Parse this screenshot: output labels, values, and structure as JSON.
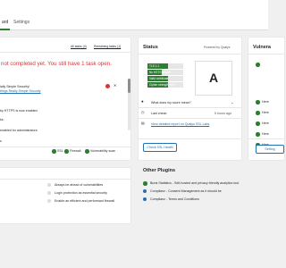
{
  "tabs": [
    {
      "label": "ard"
    },
    {
      "label": "Settings"
    }
  ],
  "progress": {
    "filter_all": "All tasks (4)",
    "filter_remaining": "Remaining tasks (1)",
    "headline": "not completed yet. You still have 1 task open.",
    "task1_line1": "ially Simple Security!",
    "task1_link": "ttings Really Simple Security",
    "badge_count": "1",
    "task2": "by HTTPS is now enabled.",
    "task3": "ks.",
    "task4": "enabled for administrators.",
    "task5": "s",
    "footer": [
      {
        "label": "SSL"
      },
      {
        "label": "Firewall"
      },
      {
        "label": "Vulnerability scan"
      }
    ]
  },
  "status": {
    "title": "Status",
    "powered_by": "Powered by Qualys",
    "bars": [
      {
        "label": "TLS 1.1",
        "percent": 58
      },
      {
        "label": "No HSTS header",
        "percent": 40
      },
      {
        "label": "Valid certificate",
        "percent": 58
      },
      {
        "label": "Cipher strength 90%",
        "percent": 58
      }
    ],
    "grade": "A",
    "what_score": "What does my score mean?",
    "last_check_label": "Last check:",
    "last_check_value": "5 hours ago",
    "report_link": "View detailed report on Qualys SSL Labs",
    "check_button": "Check SSL Health"
  },
  "vulnerabilities": {
    "title": "Vulnera",
    "items": [
      "Here",
      "Here",
      "Here",
      "Here",
      "Here"
    ],
    "button": "Setting"
  },
  "security": {
    "items": [
      "Always be ahead of vulnerabilities",
      "Login protection as essential security",
      "Enable an efficient and performant firewall"
    ]
  },
  "plugins": {
    "title": "Other Plugins",
    "items": [
      {
        "label": "Burst Statistics - Self-hosted and privacy-friendly analytics tool.",
        "color": "#2e7d32"
      },
      {
        "label": "Complianz - Consent Management as it should be",
        "color": "#2271b1"
      },
      {
        "label": "Complianz - Terms and Conditions",
        "color": "#2271b1"
      }
    ]
  },
  "colors": {
    "accent_green": "#2e7d32",
    "error_red": "#d63638",
    "link_blue": "#2271b1"
  }
}
